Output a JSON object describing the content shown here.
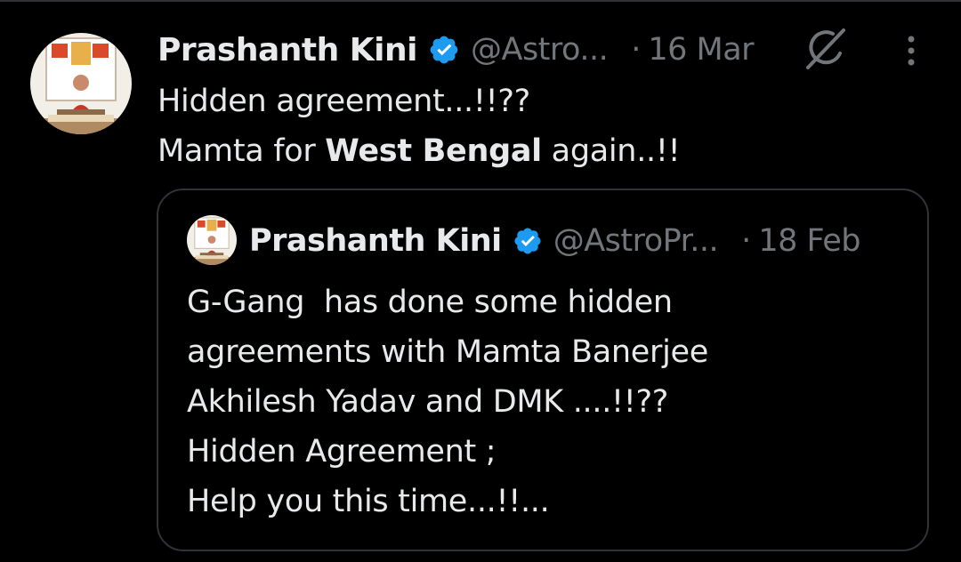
{
  "tweet": {
    "author_name": "Prashanth Kini",
    "handle": "@Astro...",
    "separator": "·",
    "time": "16 Mar",
    "text_line1": "Hidden agreement...!!??",
    "text_line2_pre": "Mamta for ",
    "text_line2_bold": "West Bengal",
    "text_line2_post": " again..!!",
    "icons": {
      "avatar": "avatar",
      "verified": "verified-badge-icon",
      "grok": "grok-icon",
      "more": "more-options-icon"
    }
  },
  "quoted_tweet": {
    "author_name": "Prashanth Kini",
    "handle": "@AstroPr...",
    "separator": "·",
    "time": "18 Feb",
    "lines": [
      "G-Gang  has done some hidden",
      "agreements with Mamta Banerjee",
      "Akhilesh Yadav and DMK ....!!??",
      "Hidden Agreement ;",
      "Help you this time...!!..."
    ]
  },
  "colors": {
    "background": "#000000",
    "text_primary": "#e7e9ea",
    "text_secondary": "#71767b",
    "verified_blue": "#1d9bf0",
    "border": "#2f3336"
  }
}
